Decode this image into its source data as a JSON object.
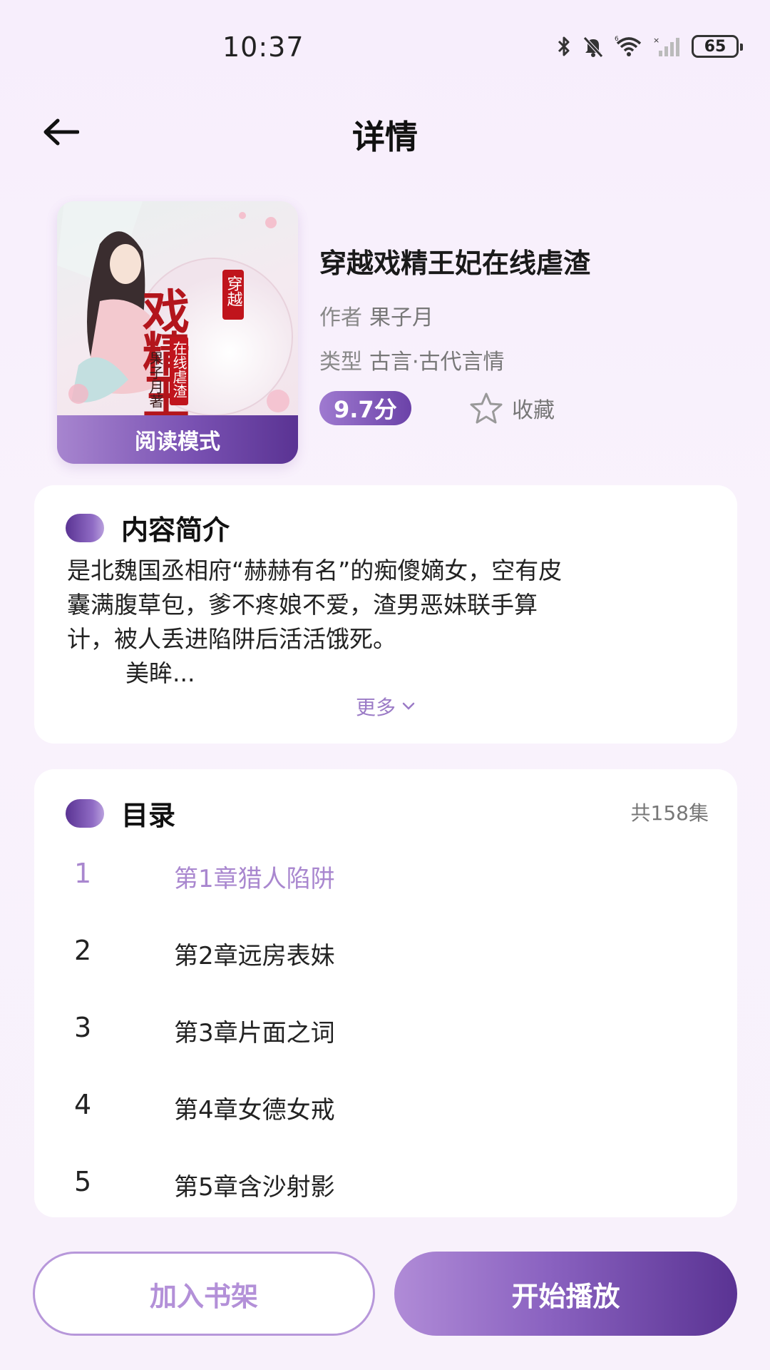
{
  "status_bar": {
    "time": "10:37",
    "battery": "65"
  },
  "header": {
    "title": "详情"
  },
  "book": {
    "cover_badge": "阅读模式",
    "title": "穿越戏精王妃在线虐渣",
    "author_label": "作者",
    "author": "果子月",
    "type_label": "类型",
    "type": "古言·古代言情",
    "score": "9.7分",
    "favorite_label": "收藏",
    "cover_text": {
      "main": "戏精王妃",
      "tag": "穿越",
      "sub": "在线虐渣",
      "author_sign": "果子月著"
    }
  },
  "intro": {
    "title": "内容简介",
    "lines": [
      "是北魏国丞相府“赫赫有名”的痴傻嫡女，空有皮",
      "囊满腹草包，爹不疼娘不爱，渣男恶妹联手算",
      "计，被人丢进陷阱后活活饿死。",
      "美眸..."
    ],
    "more_label": "更多"
  },
  "catalog": {
    "title": "目录",
    "count": "共158集",
    "chapters": [
      {
        "num": "1",
        "name": "第1章猎人陷阱"
      },
      {
        "num": "2",
        "name": "第2章远房表妹"
      },
      {
        "num": "3",
        "name": "第3章片面之词"
      },
      {
        "num": "4",
        "name": "第4章女德女戒"
      },
      {
        "num": "5",
        "name": "第5章含沙射影"
      }
    ]
  },
  "actions": {
    "shelf_label": "加入书架",
    "play_label": "开始播放"
  },
  "colors": {
    "accent": "#7a52b3",
    "accent_light": "#b390d8",
    "active_chapter": "#a987cf"
  }
}
